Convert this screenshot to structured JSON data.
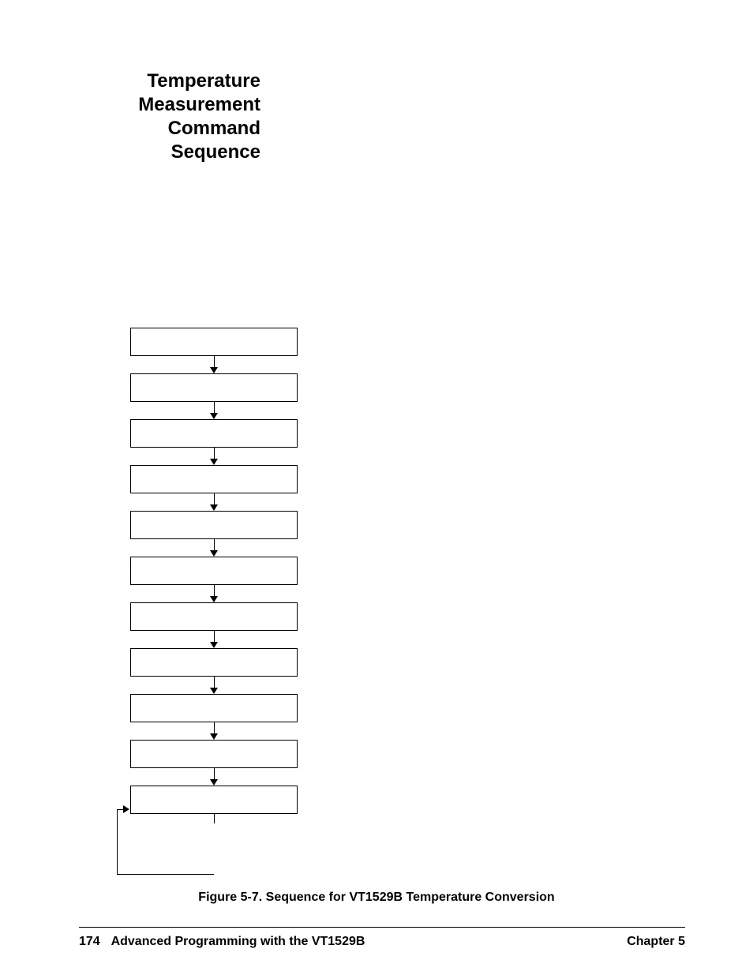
{
  "heading": {
    "line1": "Temperature",
    "line2": "Measurement",
    "line3": "Command",
    "line4": "Sequence"
  },
  "caption": "Figure 5-7. Sequence for VT1529B Temperature Conversion",
  "footer": {
    "page_number": "174",
    "title": "Advanced Programming with the VT1529B",
    "chapter": "Chapter 5"
  }
}
